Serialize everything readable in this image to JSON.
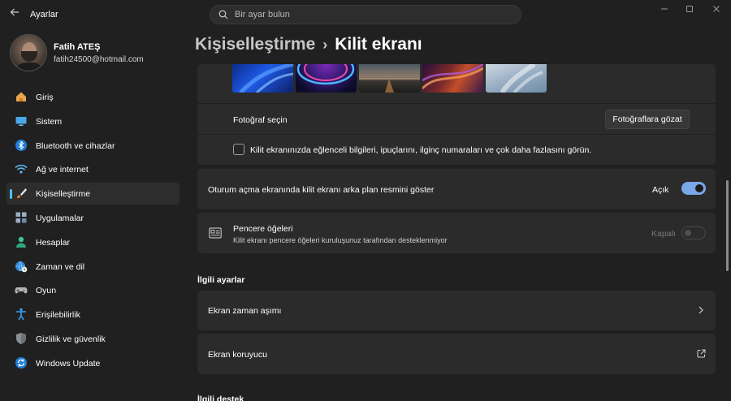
{
  "app": {
    "title": "Ayarlar"
  },
  "search": {
    "placeholder": "Bir ayar bulun"
  },
  "profile": {
    "name": "Fatih ATEŞ",
    "email": "fatih24500@hotmail.com"
  },
  "sidebar": {
    "items": [
      {
        "label": "Giriş",
        "icon": "home-icon"
      },
      {
        "label": "Sistem",
        "icon": "monitor-icon"
      },
      {
        "label": "Bluetooth ve cihazlar",
        "icon": "bluetooth-icon"
      },
      {
        "label": "Ağ ve internet",
        "icon": "wifi-icon"
      },
      {
        "label": "Kişiselleştirme",
        "icon": "paintbrush-icon",
        "active": true
      },
      {
        "label": "Uygulamalar",
        "icon": "apps-icon"
      },
      {
        "label": "Hesaplar",
        "icon": "person-icon"
      },
      {
        "label": "Zaman ve dil",
        "icon": "globe-clock-icon"
      },
      {
        "label": "Oyun",
        "icon": "gamepad-icon"
      },
      {
        "label": "Erişilebilirlik",
        "icon": "accessibility-icon"
      },
      {
        "label": "Gizlilik ve güvenlik",
        "icon": "shield-icon"
      },
      {
        "label": "Windows Update",
        "icon": "update-icon"
      }
    ]
  },
  "breadcrumb": {
    "parent": "Kişiselleştirme",
    "separator": "›",
    "current": "Kilit ekranı"
  },
  "photo": {
    "choose_label": "Fotoğraf seçin",
    "browse_button": "Fotoğraflara gözat",
    "fun_facts_label": "Kilit ekranınızda eğlenceli bilgileri, ipuçlarını, ilginç numaraları ve çok daha fazlasını görün."
  },
  "signin_bg": {
    "label": "Oturum açma ekranında kilit ekranı arka plan resmini göster",
    "state": "Açık",
    "on": true
  },
  "widgets": {
    "title": "Pencere öğeleri",
    "subtitle": "Kilit ekranı pencere öğeleri kuruluşunuz tarafından desteklenmiyor",
    "state": "Kapalı",
    "on": false
  },
  "related": {
    "title": "İlgili ayarlar",
    "items": [
      {
        "label": "Ekran zaman aşımı",
        "icon": "chevron-right-icon"
      },
      {
        "label": "Ekran koruyucu",
        "icon": "external-link-icon"
      }
    ]
  },
  "support": {
    "title": "İlgili destek"
  },
  "colors": {
    "accent": "#4cc2ff",
    "toggle_on": "#7aa7e8",
    "card": "#2b2b2b",
    "background": "#202020"
  }
}
